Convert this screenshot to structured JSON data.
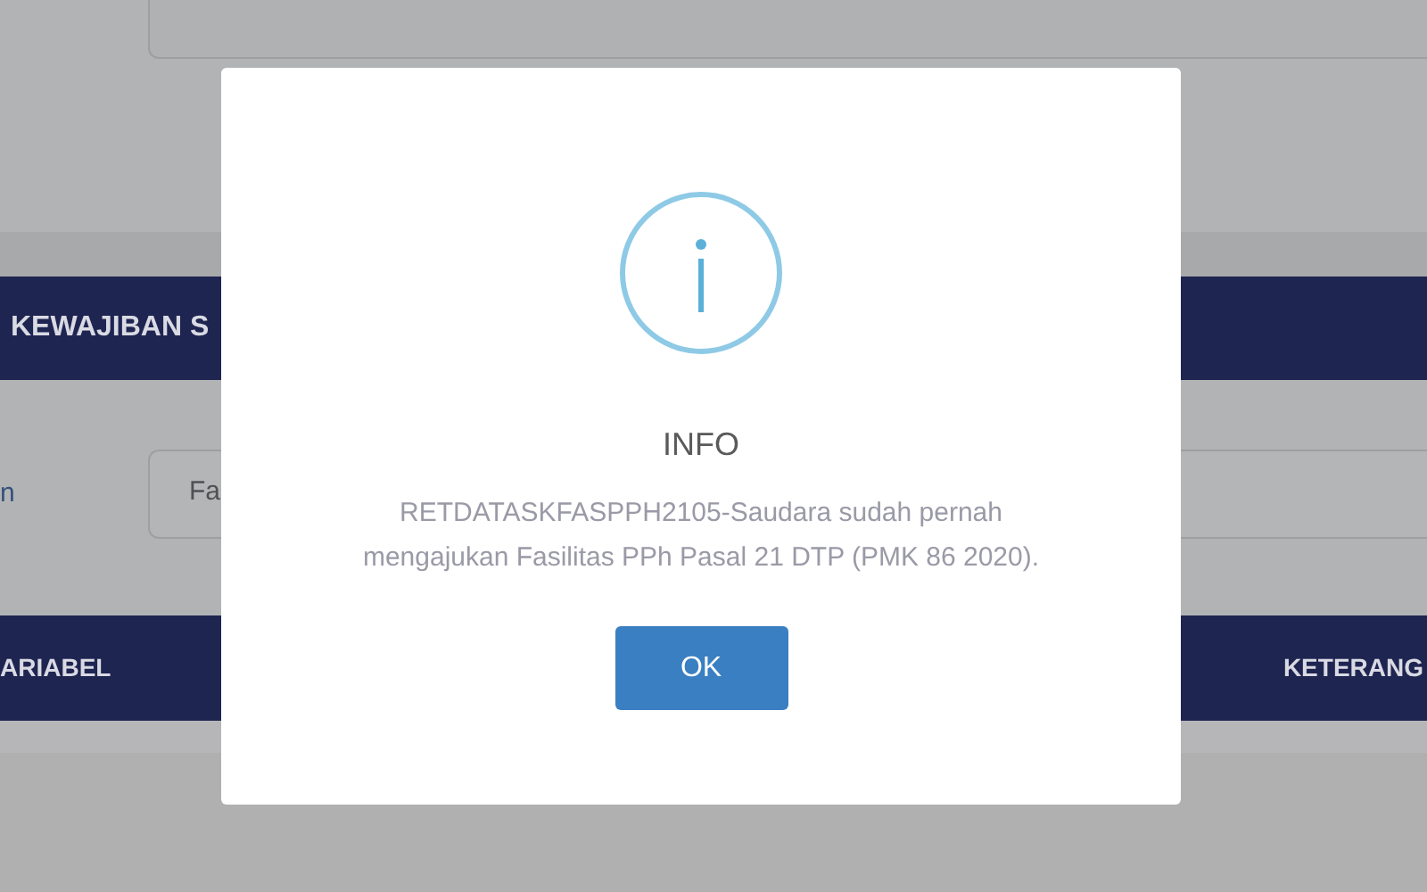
{
  "section_title": "KEWAJIBAN S",
  "form": {
    "label": "n",
    "field_value": "Fa"
  },
  "table": {
    "columns": [
      "ARIABEL",
      "KETERANG"
    ]
  },
  "dialog": {
    "title": "INFO",
    "message": "RETDATASKFASPPH2105-Saudara sudah pernah mengajukan Fasilitas PPh Pasal 21 DTP (PMK 86 2020).",
    "buttons": [
      "OK"
    ]
  }
}
